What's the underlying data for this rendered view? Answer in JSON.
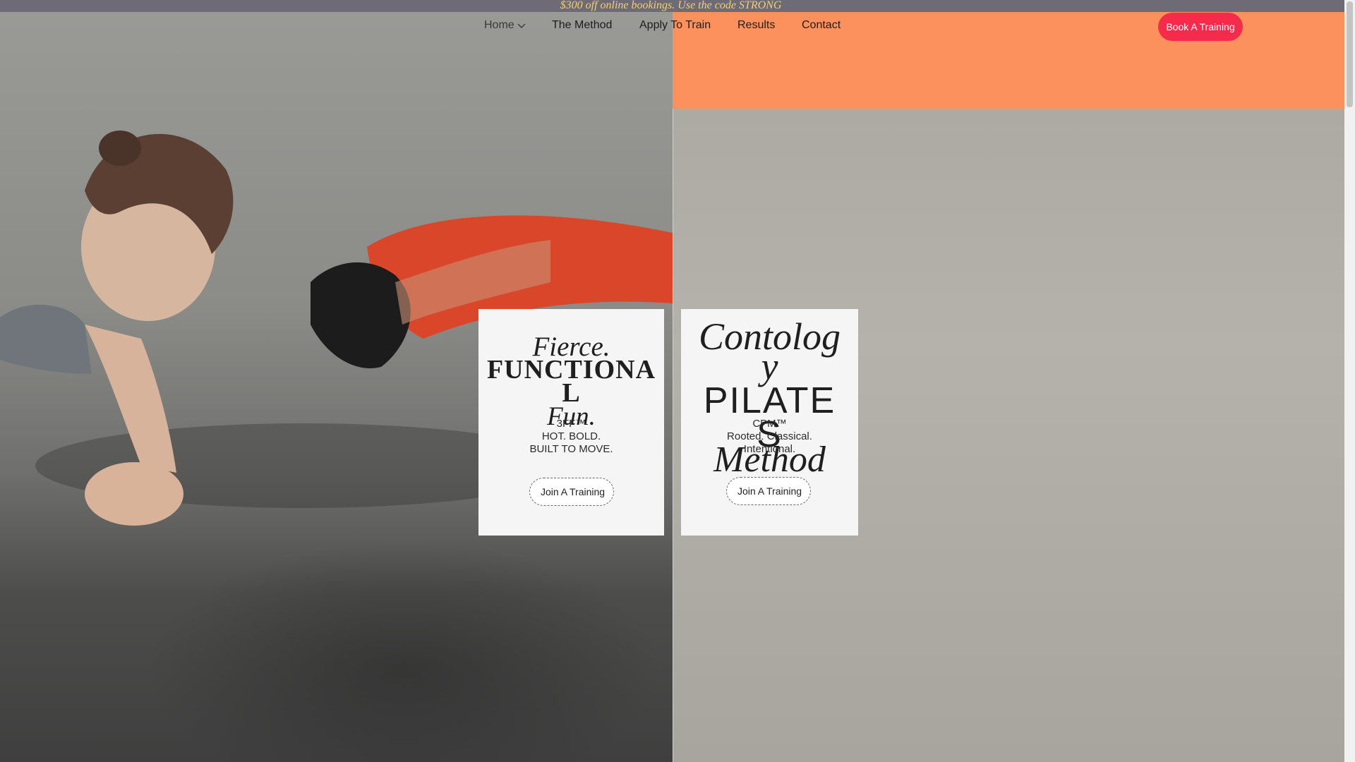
{
  "promo": {
    "text": "$300 off online bookings. Use the code STRONG"
  },
  "nav": {
    "items": [
      {
        "label": "Home",
        "has_dropdown": true
      },
      {
        "label": "The Method"
      },
      {
        "label": "Apply To Train"
      },
      {
        "label": "Results"
      },
      {
        "label": "Contact"
      }
    ],
    "cta_label": "Book A Training"
  },
  "cards": [
    {
      "line1": "Fierce.",
      "line2": "FUNCTIONAL",
      "line3": "Fun.",
      "sub": [
        "3FF™",
        "HOT. BOLD.",
        "BUILT TO MOVE."
      ],
      "button": "Join A Training"
    },
    {
      "line1": "Contology",
      "line2": "PILATES",
      "line3": "Method",
      "sub": [
        "CPM™",
        "Rooted. Classical.",
        "Intentional."
      ],
      "button": "Join A Training"
    }
  ],
  "colors": {
    "accent_orange": "#fd915d",
    "cta_red": "#f62b4b",
    "promo_bar": "#6e6a76",
    "promo_text": "#f2d36a",
    "card_bg": "#f5f5f5"
  },
  "icons": {
    "home_dropdown": "chevron-down-icon"
  }
}
